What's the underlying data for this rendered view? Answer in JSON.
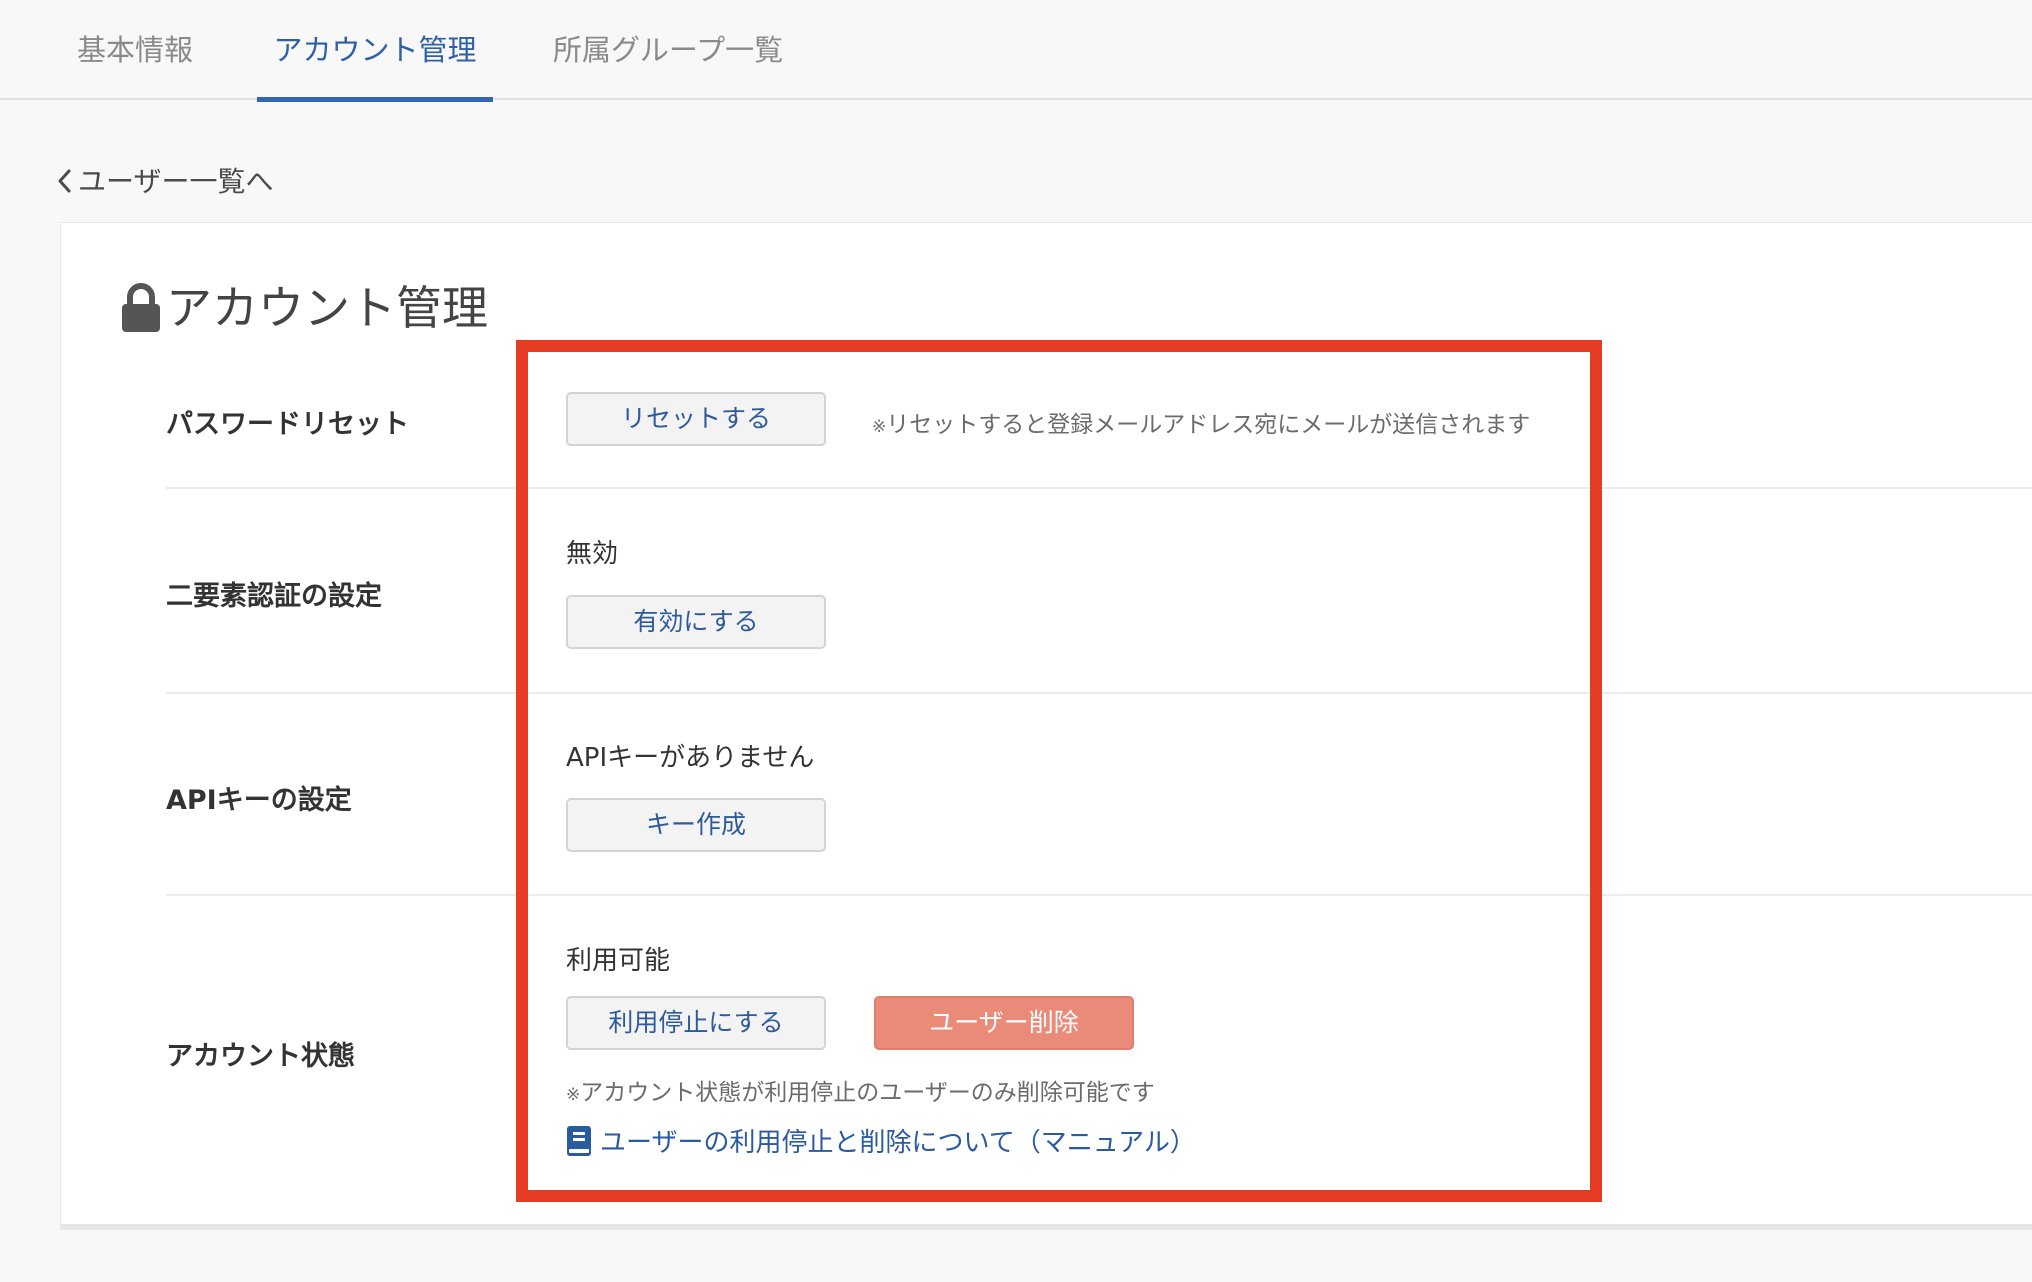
{
  "tabs": [
    {
      "label": "基本情報"
    },
    {
      "label": "アカウント管理"
    },
    {
      "label": "所属グループ一覧"
    }
  ],
  "back_link": {
    "label": "ユーザー一覧へ",
    "icon": "chevron-left-icon"
  },
  "page": {
    "title": "アカウント管理",
    "icon": "lock-icon"
  },
  "password_reset": {
    "label": "パスワードリセット",
    "button": "リセットする",
    "note_mark": "※",
    "note": "リセットすると登録メールアドレス宛にメールが送信されます"
  },
  "two_factor": {
    "label": "二要素認証の設定",
    "status": "無効",
    "button": "有効にする"
  },
  "api_key": {
    "label": "APIキーの設定",
    "status": "APIキーがありません",
    "button": "キー作成"
  },
  "account_status": {
    "label": "アカウント状態",
    "status": "利用可能",
    "suspend_button": "利用停止にする",
    "delete_button": "ユーザー削除",
    "note_mark": "※",
    "note": "アカウント状態が利用停止のユーザーのみ削除可能です",
    "manual_link": "ユーザーの利用停止と削除について（マニュアル）",
    "manual_icon": "manual-book-icon"
  },
  "colors": {
    "accent": "#3366b2",
    "link": "#2a5aa0",
    "danger_button": "#ea8a78",
    "highlight_border": "#e63c24",
    "page_background": "#f8f8f8"
  }
}
